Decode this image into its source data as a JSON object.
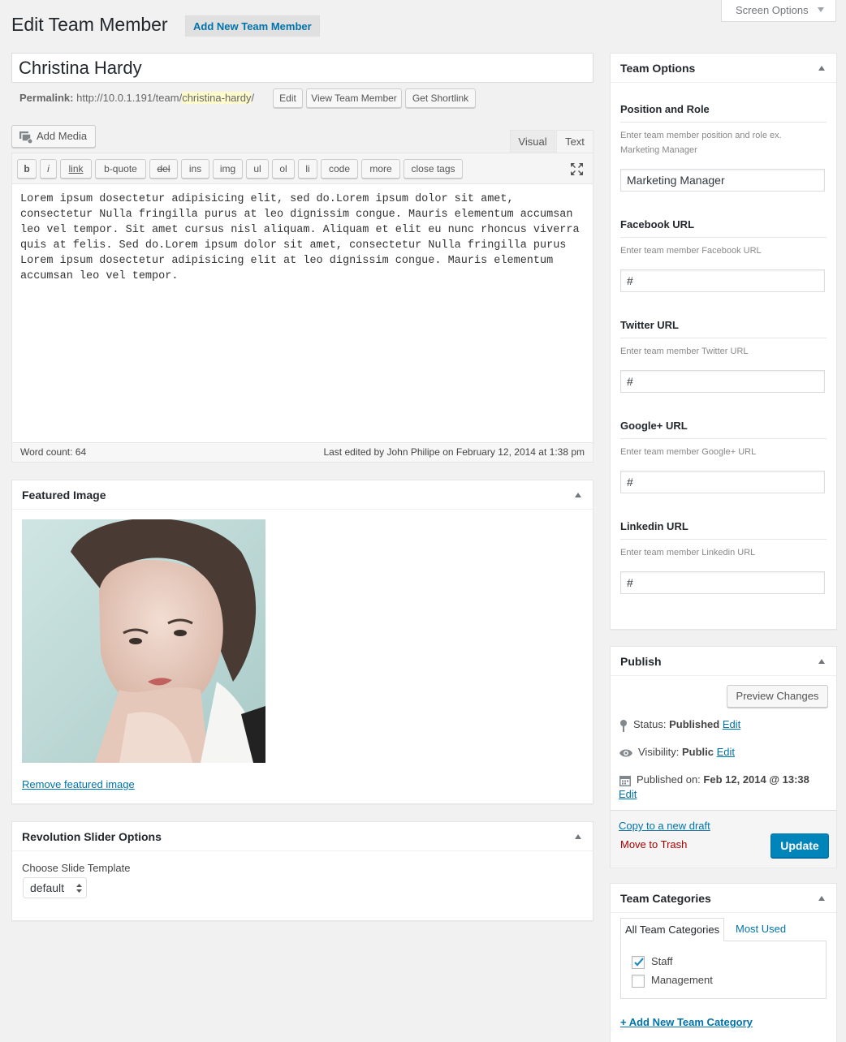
{
  "header": {
    "title": "Edit Team Member",
    "add_new": "Add New Team Member",
    "screen_options": "Screen Options"
  },
  "post": {
    "title": "Christina Hardy",
    "permalink_label": "Permalink:",
    "permalink_base": "http://10.0.1.191/team/",
    "permalink_slug": "christina-hardy",
    "permalink_trail": "/",
    "edit_btn": "Edit",
    "view_btn": "View Team Member",
    "shortlink_btn": "Get Shortlink"
  },
  "editor": {
    "add_media": "Add Media",
    "tab_visual": "Visual",
    "tab_text": "Text",
    "quicktags": [
      "b",
      "i",
      "link",
      "b-quote",
      "del",
      "ins",
      "img",
      "ul",
      "ol",
      "li",
      "code",
      "more",
      "close tags"
    ],
    "content": "Lorem ipsum dosectetur adipisicing elit, sed do.Lorem ipsum dolor sit amet, consectetur Nulla fringilla purus at leo dignissim congue. Mauris elementum accumsan leo vel tempor. Sit amet cursus nisl aliquam. Aliquam et elit eu nunc rhoncus viverra quis at felis. Sed do.Lorem ipsum dolor sit amet, consectetur Nulla fringilla purus Lorem ipsum dosectetur adipisicing elit at leo dignissim congue. Mauris elementum accumsan leo vel tempor.",
    "word_count": "Word count: 64",
    "last_edited": "Last edited by John Philipe on February 12, 2014 at 1:38 pm"
  },
  "featured_image": {
    "title": "Featured Image",
    "remove_link": "Remove featured image"
  },
  "revslider": {
    "title": "Revolution Slider Options",
    "label": "Choose Slide Template",
    "selected": "default"
  },
  "team_options": {
    "title": "Team Options",
    "fields": [
      {
        "label": "Position and Role",
        "desc": "Enter team member position and role ex. Marketing Manager",
        "value": "Marketing Manager"
      },
      {
        "label": "Facebook URL",
        "desc": "Enter team member Facebook URL",
        "value": "#"
      },
      {
        "label": "Twitter URL",
        "desc": "Enter team member Twitter URL",
        "value": "#"
      },
      {
        "label": "Google+ URL",
        "desc": "Enter team member Google+ URL",
        "value": "#"
      },
      {
        "label": "Linkedin URL",
        "desc": "Enter team member Linkedin URL",
        "value": "#"
      }
    ]
  },
  "publish": {
    "title": "Publish",
    "preview": "Preview Changes",
    "status_label": "Status:",
    "status_value": "Published",
    "visibility_label": "Visibility:",
    "visibility_value": "Public",
    "published_label": "Published on:",
    "published_value": "Feb 12, 2014 @ 13:38",
    "edit": "Edit",
    "copy_draft": "Copy to a new draft",
    "trash": "Move to Trash",
    "update": "Update",
    "colors": {
      "update_bg": "#0085ba",
      "trash": "#a00"
    }
  },
  "categories": {
    "title": "Team Categories",
    "tab_all": "All Team Categories",
    "tab_used": "Most Used",
    "items": [
      {
        "label": "Staff",
        "checked": true
      },
      {
        "label": "Management",
        "checked": false
      }
    ],
    "add_new": "+ Add New Team Category"
  }
}
